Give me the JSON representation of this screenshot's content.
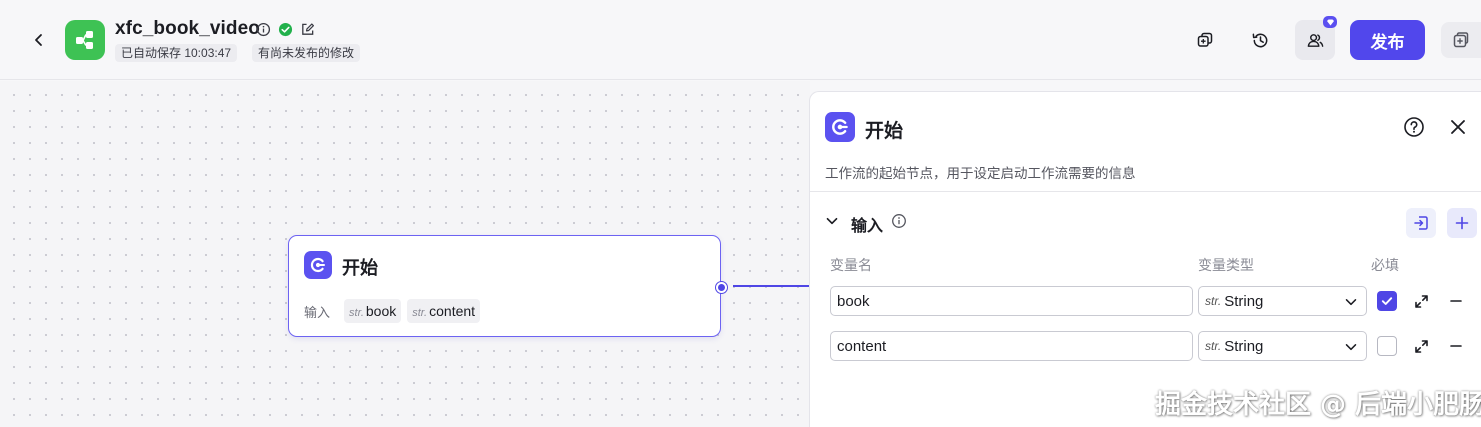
{
  "header": {
    "title": "xfc_book_video",
    "saved_status": "已自动保存 10:03:47",
    "unpublished_status": "有尚未发布的修改",
    "publish_label": "发布",
    "accent_color": "#5147ec",
    "logo_color": "#3ec254",
    "icons": [
      "back-icon",
      "info-icon",
      "verified-check-icon",
      "edit-icon",
      "copy-icon",
      "history-icon",
      "collaborators-icon",
      "add-panel-icon"
    ]
  },
  "canvas": {
    "node": {
      "title": "开始",
      "io_label": "输入",
      "type_prefix": "str.",
      "params": [
        "book",
        "content"
      ]
    }
  },
  "panel": {
    "title": "开始",
    "description": "工作流的起始节点，用于设定启动工作流需要的信息",
    "section_title": "输入",
    "columns": {
      "name": "变量名",
      "type": "变量类型",
      "required": "必填"
    },
    "rows": [
      {
        "name": "book",
        "type_prefix": "str.",
        "type": "String",
        "required": true
      },
      {
        "name": "content",
        "type_prefix": "str.",
        "type": "String",
        "required": false
      }
    ]
  },
  "watermark": "掘金技术社区 @ 后端小肥肠"
}
